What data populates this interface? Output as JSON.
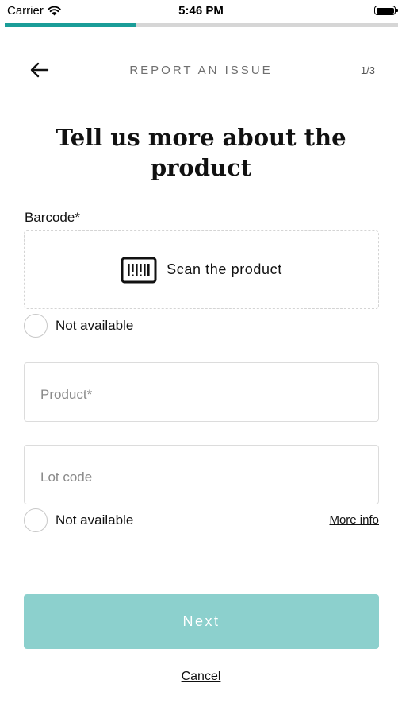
{
  "status_bar": {
    "carrier": "Carrier",
    "time": "5:46 PM"
  },
  "progress": {
    "fraction": 0.333,
    "color": "#1a9d98",
    "track_color": "#d6d6d6"
  },
  "header": {
    "title": "REPORT AN ISSUE",
    "step": "1/3",
    "back_icon": "arrow-left-icon"
  },
  "page": {
    "title": "Tell us more about the product"
  },
  "barcode": {
    "label": "Barcode*",
    "scan_label": "Scan the product",
    "scan_icon": "barcode-icon",
    "not_available_label": "Not available"
  },
  "product": {
    "placeholder": "Product*",
    "value": ""
  },
  "lot_code": {
    "placeholder": "Lot code",
    "value": "",
    "not_available_label": "Not available",
    "more_info_label": "More info"
  },
  "actions": {
    "next_label": "Next",
    "next_color": "#8cd0cd",
    "cancel_label": "Cancel"
  }
}
